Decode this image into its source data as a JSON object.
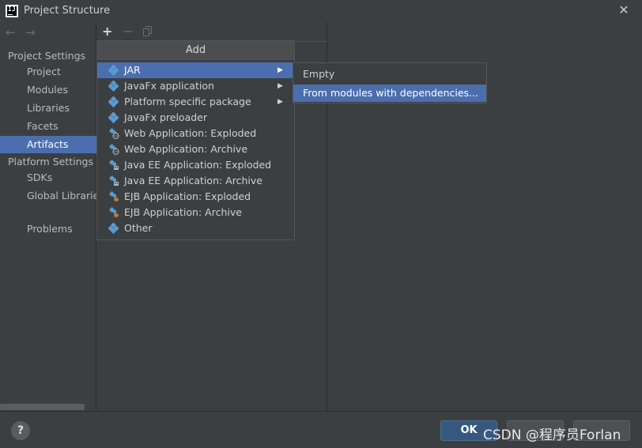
{
  "window": {
    "title": "Project Structure",
    "close_glyph": "✕"
  },
  "nav": {
    "back_glyph": "←",
    "forward_glyph": "→",
    "project_settings_header": "Project Settings",
    "project_settings_items": [
      {
        "label": "Project"
      },
      {
        "label": "Modules"
      },
      {
        "label": "Libraries"
      },
      {
        "label": "Facets"
      },
      {
        "label": "Artifacts",
        "selected": true
      }
    ],
    "platform_settings_header": "Platform Settings",
    "platform_settings_items": [
      {
        "label": "SDKs"
      },
      {
        "label": "Global Libraries"
      }
    ],
    "problems_label": "Problems"
  },
  "toolbar": {
    "add_glyph": "+",
    "remove_glyph": "−"
  },
  "add_popup": {
    "title": "Add",
    "submenu_arrow": "▶",
    "items": [
      {
        "label": "JAR",
        "icon": "artifact-icon",
        "has_submenu": true,
        "selected": true
      },
      {
        "label": "JavaFx application",
        "icon": "artifact-icon",
        "has_submenu": true
      },
      {
        "label": "Platform specific package",
        "icon": "artifact-icon",
        "has_submenu": true
      },
      {
        "label": "JavaFx preloader",
        "icon": "artifact-icon"
      },
      {
        "label": "Web Application: Exploded",
        "icon": "web-artifact-icon"
      },
      {
        "label": "Web Application: Archive",
        "icon": "web-artifact-icon"
      },
      {
        "label": "Java EE Application: Exploded",
        "icon": "javaee-artifact-icon"
      },
      {
        "label": "Java EE Application: Archive",
        "icon": "javaee-artifact-icon"
      },
      {
        "label": "EJB Application: Exploded",
        "icon": "ejb-artifact-icon"
      },
      {
        "label": "EJB Application: Archive",
        "icon": "ejb-artifact-icon"
      },
      {
        "label": "Other",
        "icon": "artifact-icon"
      }
    ]
  },
  "jar_submenu": {
    "items": [
      {
        "label": "Empty"
      },
      {
        "label": "From modules with dependencies...",
        "selected": true
      }
    ]
  },
  "buttons": {
    "help": "?",
    "ok": "OK"
  },
  "watermark": "CSDN @程序员Forlan",
  "colors": {
    "accent": "#4b6eaf",
    "background": "#3c3f41",
    "ok_button": "#365880",
    "icon_blue": "#5c9bd1"
  }
}
